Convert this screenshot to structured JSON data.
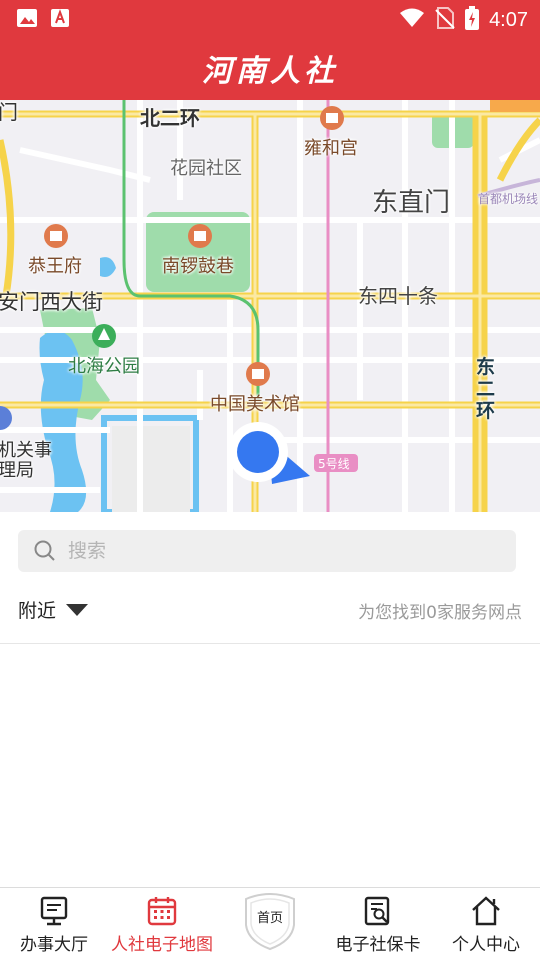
{
  "status_bar": {
    "time": "4:07",
    "left_icons": [
      "image-icon",
      "text-app-icon"
    ],
    "right_icons": [
      "wifi-icon",
      "no-sim-icon",
      "battery-charging-icon"
    ]
  },
  "header": {
    "title": "河南人社",
    "background": "#e0393e"
  },
  "map": {
    "labels": {
      "north_second_ring": "北二环",
      "yonghe_temple": "雍和宫",
      "huayuan_community": "花园社区",
      "dongzhimen": "东直门",
      "capital_airport_expressway": "首都机场线",
      "gongwang_mansion": "恭王府",
      "nanluoguxiang": "南锣鼓巷",
      "dianmen_west_street": "安门西大街",
      "dongsi_shitiao": "东四十条",
      "beihai_park": "北海公园",
      "national_art_museum": "中国美术馆",
      "east_second_ring": "东\n二\n环",
      "line5": "5号线",
      "government_office_1": "机关事",
      "government_office_2": "理局",
      "top_left_partial": "门"
    }
  },
  "search": {
    "placeholder": "搜索",
    "value": ""
  },
  "filter": {
    "nearby_label": "附近",
    "result_text": "为您找到0家服务网点"
  },
  "tabbar": {
    "tabs": [
      {
        "label": "办事大厅",
        "icon": "monitor-icon",
        "active": false
      },
      {
        "label": "人社电子地图",
        "icon": "calendar-grid-icon",
        "active": true
      },
      {
        "label": "首页",
        "icon": "shield-home-icon",
        "active": false
      },
      {
        "label": "电子社保卡",
        "icon": "card-search-icon",
        "active": false
      },
      {
        "label": "个人中心",
        "icon": "house-icon",
        "active": false
      }
    ],
    "active_color": "#e0393e"
  }
}
